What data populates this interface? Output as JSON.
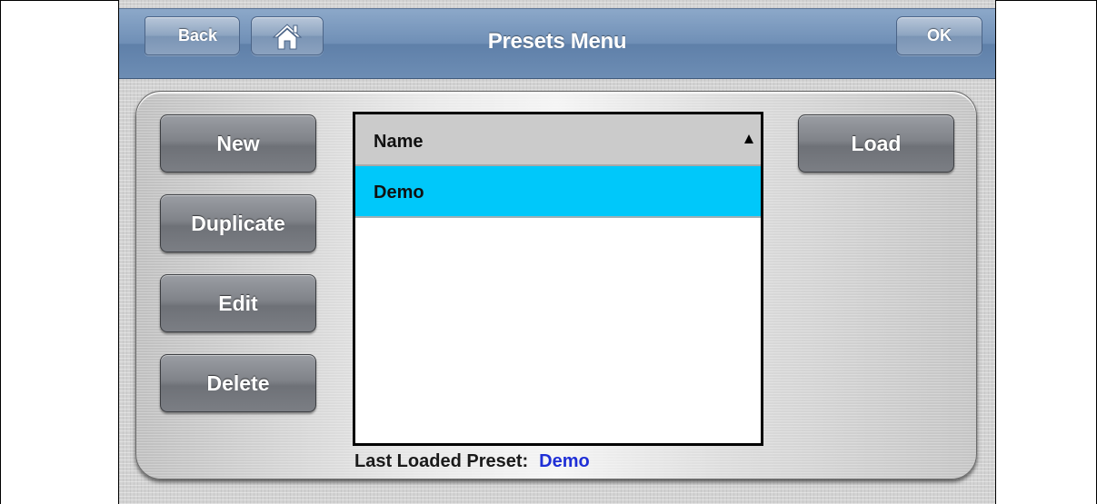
{
  "header": {
    "title": "Presets Menu",
    "back_label": "Back",
    "ok_label": "OK",
    "home_icon": "home-icon"
  },
  "actions": {
    "new_label": "New",
    "duplicate_label": "Duplicate",
    "edit_label": "Edit",
    "delete_label": "Delete",
    "load_label": "Load"
  },
  "presets_list": {
    "column_header": "Name",
    "sort_order": "ascending",
    "rows": [
      {
        "name": "Demo",
        "selected": true
      }
    ]
  },
  "status": {
    "last_loaded_label": "Last Loaded Preset:",
    "last_loaded_value": "Demo"
  },
  "colors": {
    "titlebar": "#6f8fb6",
    "selected_row": "#00c8fa",
    "status_value": "#1f2fd6"
  }
}
